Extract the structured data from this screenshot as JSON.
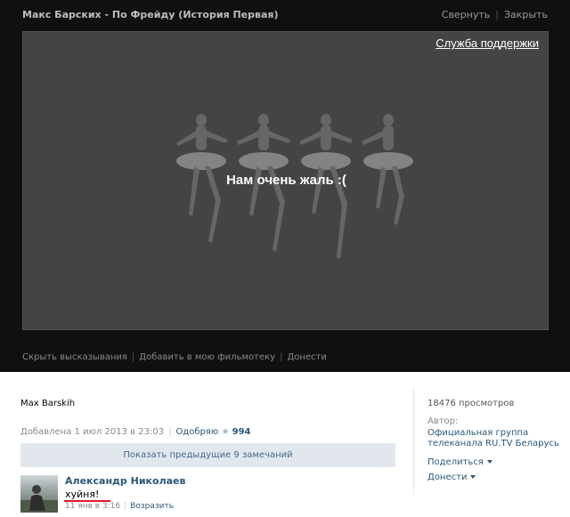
{
  "window": {
    "title": "Макс Барских - По Фрейду (История Первая)",
    "minimize_label": "Свернуть",
    "close_label": "Закрыть"
  },
  "player": {
    "support_link": "Служба поддержки",
    "error_message": "Нам очень жаль :("
  },
  "video_actions": {
    "hide_comments": "Скрыть высказывания",
    "add_to_library": "Добавить в мою фильмотеку",
    "report": "Донести"
  },
  "video_info": {
    "uploader": "Max Barskih",
    "added": "Добавлена 1 июл 2013 в 23:03",
    "like_label": "Одобряю",
    "like_count": "994"
  },
  "comments": {
    "show_previous": "Показать предыдущие 9 замечаний",
    "items": [
      {
        "author": "Александр Николаев",
        "text": "хуйня!",
        "date": "11 янв в 3:16",
        "reply_label": "Возразить"
      }
    ]
  },
  "sidebar": {
    "views": "18476 просмотров",
    "author_label": "Автор:",
    "author_name": "Официальная группа телеканала RU.TV Беларусь",
    "share_label": "Поделиться",
    "report_label": "Донести"
  },
  "colors": {
    "link": "#2b587a",
    "dark_bg": "#101010",
    "player_bg": "#444444",
    "button_bg": "#e1e7ed"
  }
}
